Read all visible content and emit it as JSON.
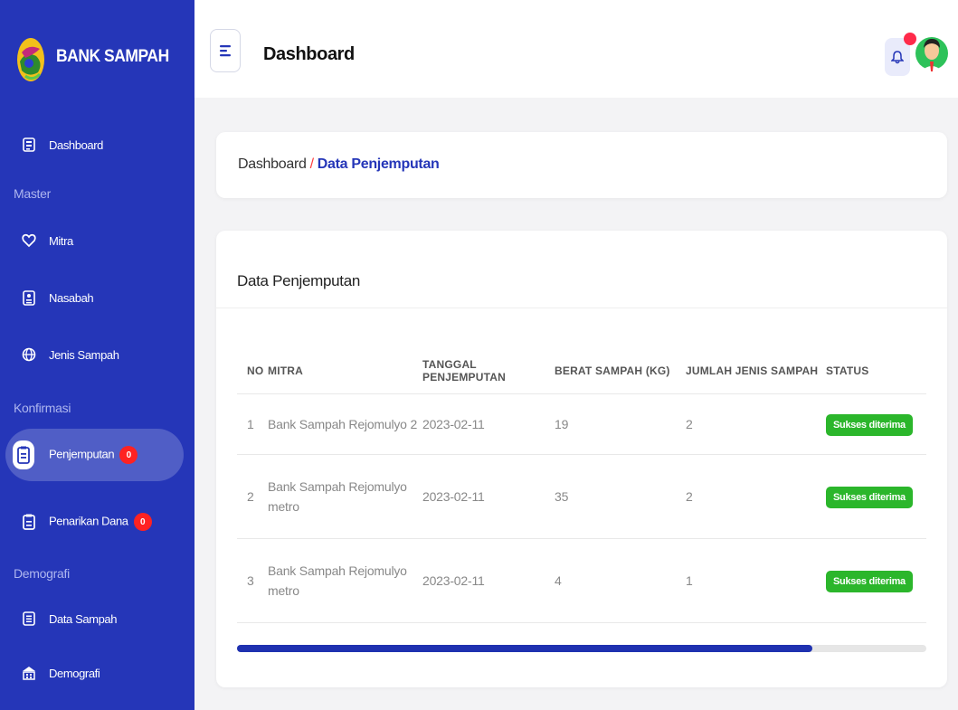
{
  "brand": {
    "name": "BANK SAMPAH"
  },
  "sidebar": {
    "items": [
      {
        "label": "Dashboard",
        "icon": "dashboard-icon"
      },
      {
        "section": "Master"
      },
      {
        "label": "Mitra",
        "icon": "heart-icon"
      },
      {
        "label": "Nasabah",
        "icon": "id-card-icon"
      },
      {
        "label": "Jenis Sampah",
        "icon": "globe-icon"
      },
      {
        "section": "Konfirmasi"
      },
      {
        "label": "Penjemputan",
        "icon": "clipboard-icon",
        "badge": "0",
        "active": true
      },
      {
        "label": "Penarikan Dana",
        "icon": "clipboard-icon",
        "badge": "0"
      },
      {
        "section": "Demografi"
      },
      {
        "label": "Data Sampah",
        "icon": "document-icon"
      },
      {
        "label": "Demografi",
        "icon": "building-icon"
      }
    ]
  },
  "header": {
    "title": "Dashboard"
  },
  "breadcrumb": {
    "parent": "Dashboard",
    "separator": "/",
    "current": "Data Penjemputan"
  },
  "table_card": {
    "title": "Data Penjemputan",
    "columns": [
      "NO",
      "MITRA",
      "TANGGAL PENJEMPUTAN",
      "BERAT SAMPAH (KG)",
      "JUMLAH JENIS SAMPAH",
      "STATUS"
    ],
    "rows": [
      {
        "no": "1",
        "mitra": "Bank Sampah Rejomulyo 2",
        "tanggal": "2023-02-11",
        "berat": "19",
        "jumlah": "2",
        "status": "Sukses diterima"
      },
      {
        "no": "2",
        "mitra": "Bank Sampah Rejomulyo metro",
        "tanggal": "2023-02-11",
        "berat": "35",
        "jumlah": "2",
        "status": "Sukses diterima"
      },
      {
        "no": "3",
        "mitra": "Bank Sampah Rejomulyo metro",
        "tanggal": "2023-02-11",
        "berat": "4",
        "jumlah": "1",
        "status": "Sukses diterima"
      }
    ],
    "scroll_position": 0.835
  },
  "colors": {
    "sidebar": "#2536b8",
    "accent": "#2536b8",
    "badge": "#ff2222",
    "status_success": "#2bb62b"
  }
}
